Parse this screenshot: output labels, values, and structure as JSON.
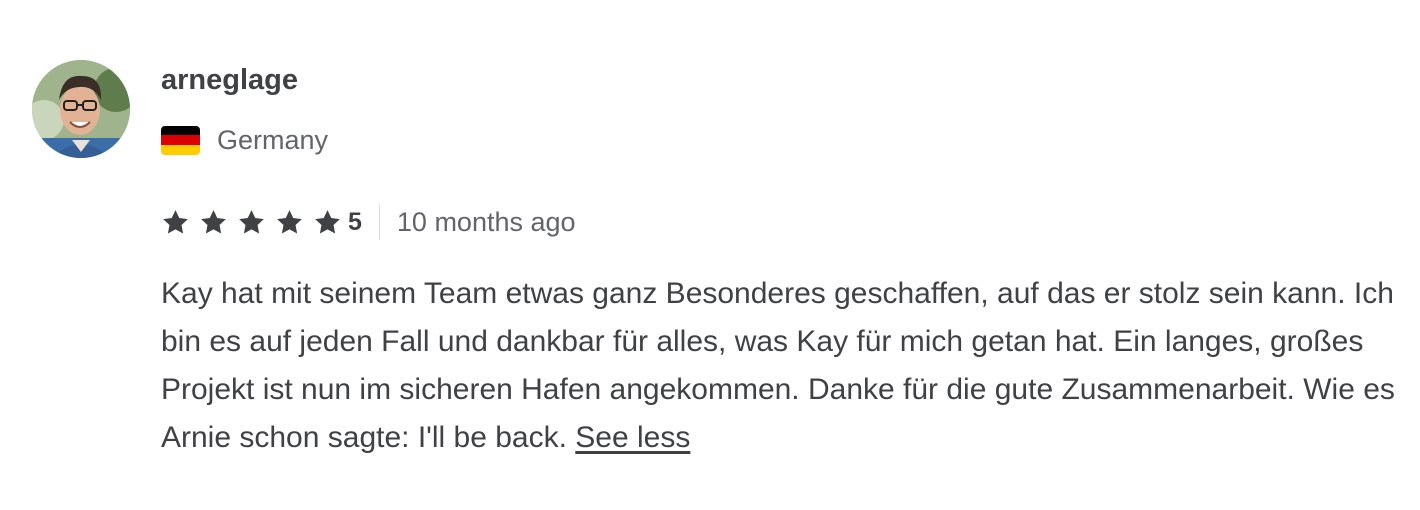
{
  "reviewer": {
    "username": "arneglage",
    "country": "Germany",
    "flag_colors": [
      "#000000",
      "#dd0000",
      "#ffce00"
    ]
  },
  "rating": {
    "stars": 5,
    "score": "5",
    "time_ago": "10 months ago",
    "star_color": "#404145"
  },
  "review": {
    "text": "Kay hat mit seinem Team etwas ganz Besonderes geschaffen, auf das er stolz sein kann. Ich bin es auf jeden Fall und dankbar für alles, was Kay für mich getan hat. Ein langes, großes Projekt ist nun im sicheren Hafen angekommen. Danke für die gute Zusammenarbeit. Wie es Arnie schon sagte: I'll be back.",
    "toggle_label": "See less"
  }
}
